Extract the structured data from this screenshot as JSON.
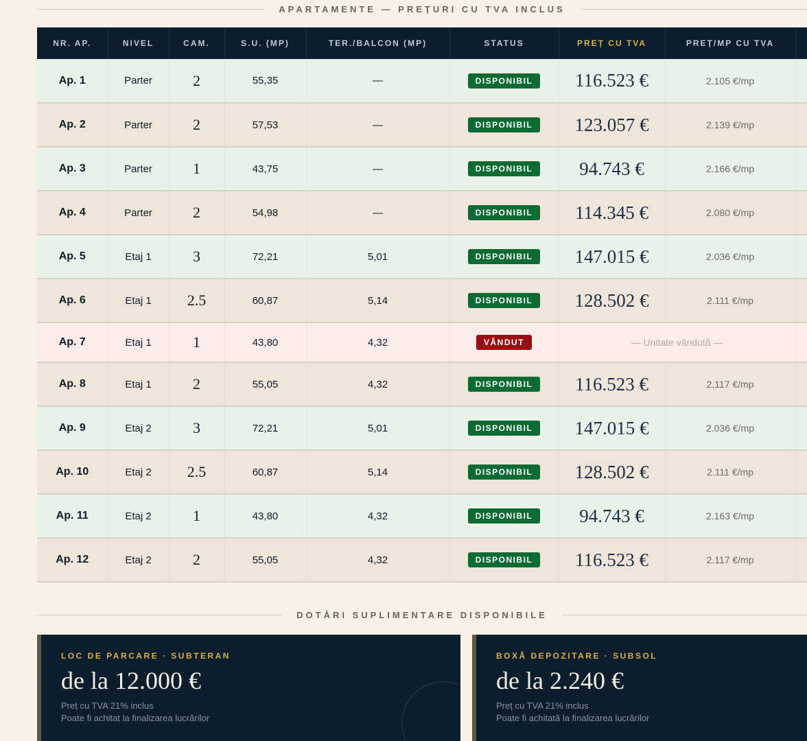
{
  "section_title": "APARTAMENTE — PREȚURI CU TVA INCLUS",
  "columns": [
    "NR. AP.",
    "NIVEL",
    "CAM.",
    "S.U. (MP)",
    "TER./BALCON (MP)",
    "STATUS",
    "PREȚ CU TVA",
    "PREȚ/MP CU TVA"
  ],
  "rows": [
    {
      "apt": "Ap. 1",
      "level": "Parter",
      "rooms": "2",
      "area": "55,35",
      "terrace": "—",
      "status": "DISPONIBIL",
      "price": "116.523 €",
      "ppm": "2.105 €/mp"
    },
    {
      "apt": "Ap. 2",
      "level": "Parter",
      "rooms": "2",
      "area": "57,53",
      "terrace": "—",
      "status": "DISPONIBIL",
      "price": "123.057 €",
      "ppm": "2.139 €/mp"
    },
    {
      "apt": "Ap. 3",
      "level": "Parter",
      "rooms": "1",
      "area": "43,75",
      "terrace": "—",
      "status": "DISPONIBIL",
      "price": "94.743 €",
      "ppm": "2.166 €/mp"
    },
    {
      "apt": "Ap. 4",
      "level": "Parter",
      "rooms": "2",
      "area": "54,98",
      "terrace": "—",
      "status": "DISPONIBIL",
      "price": "114.345 €",
      "ppm": "2.080 €/mp"
    },
    {
      "apt": "Ap. 5",
      "level": "Etaj 1",
      "rooms": "3",
      "area": "72,21",
      "terrace": "5,01",
      "status": "DISPONIBIL",
      "price": "147.015 €",
      "ppm": "2.036 €/mp"
    },
    {
      "apt": "Ap. 6",
      "level": "Etaj 1",
      "rooms": "2.5",
      "area": "60,87",
      "terrace": "5,14",
      "status": "DISPONIBIL",
      "price": "128.502 €",
      "ppm": "2.111 €/mp"
    },
    {
      "apt": "Ap. 7",
      "level": "Etaj 1",
      "rooms": "1",
      "area": "43,80",
      "terrace": "4,32",
      "status": "VÂNDUT",
      "sold_note": "— Unitate vândută —"
    },
    {
      "apt": "Ap. 8",
      "level": "Etaj 1",
      "rooms": "2",
      "area": "55,05",
      "terrace": "4,32",
      "status": "DISPONIBIL",
      "price": "116.523 €",
      "ppm": "2.117 €/mp"
    },
    {
      "apt": "Ap. 9",
      "level": "Etaj 2",
      "rooms": "3",
      "area": "72,21",
      "terrace": "5,01",
      "status": "DISPONIBIL",
      "price": "147.015 €",
      "ppm": "2.036 €/mp"
    },
    {
      "apt": "Ap. 10",
      "level": "Etaj 2",
      "rooms": "2.5",
      "area": "60,87",
      "terrace": "5,14",
      "status": "DISPONIBIL",
      "price": "128.502 €",
      "ppm": "2.111 €/mp"
    },
    {
      "apt": "Ap. 11",
      "level": "Etaj 2",
      "rooms": "1",
      "area": "43,80",
      "terrace": "4,32",
      "status": "DISPONIBIL",
      "price": "94.743 €",
      "ppm": "2.163 €/mp"
    },
    {
      "apt": "Ap. 12",
      "level": "Etaj 2",
      "rooms": "2",
      "area": "55,05",
      "terrace": "4,32",
      "status": "DISPONIBIL",
      "price": "116.523 €",
      "ppm": "2.117 €/mp"
    }
  ],
  "extras_title": "DOTĂRI SUPLIMENTARE DISPONIBILE",
  "extras": [
    {
      "label": "LOC DE PARCARE · SUBTERAN",
      "amount": "de la 12.000 €",
      "note1": "Preț cu TVA 21% inclus",
      "note2": "Poate fi achitat la finalizarea lucrărilor"
    },
    {
      "label": "BOXĂ DEPOZITARE · SUBSOL",
      "amount": "de la 2.240 €",
      "note1": "Preț cu TVA 21% inclus",
      "note2": "Poate fi achitată la finalizarea lucrărilor"
    }
  ],
  "colors": {
    "header_bg": "#0c1d2e",
    "accent_gold": "#d8b04a",
    "status_available": "#0b6b33",
    "status_sold": "#9c0c13",
    "row_green": "#e9f2e9",
    "row_beige": "#efe6d9",
    "row_sold": "#fbecea"
  }
}
